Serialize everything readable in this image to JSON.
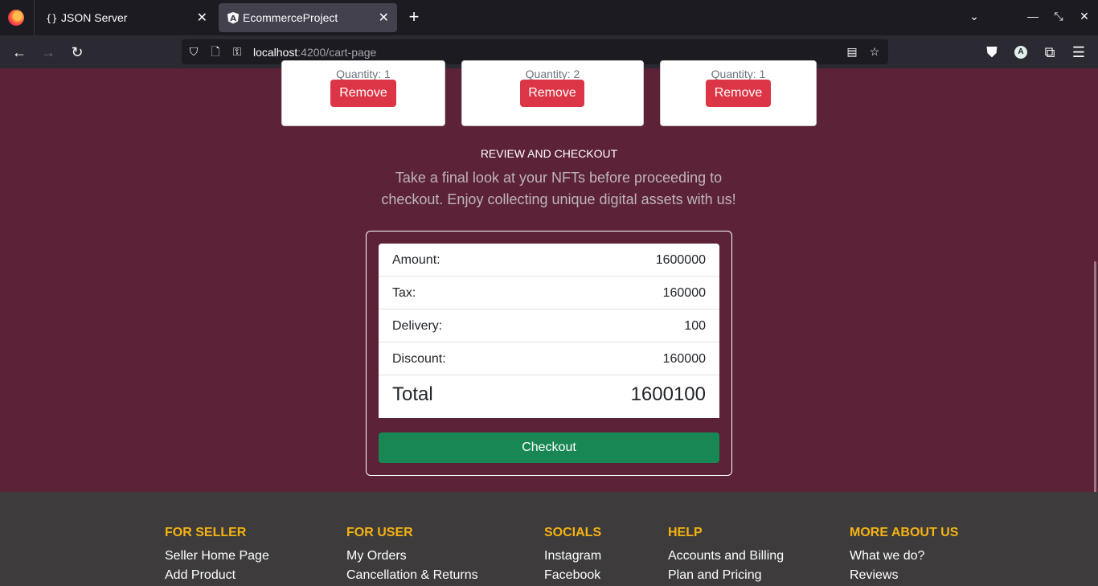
{
  "browser": {
    "tabs": [
      {
        "title": "JSON Server",
        "active": false
      },
      {
        "title": "EcommerceProject",
        "active": true
      }
    ],
    "url_host": "localhost",
    "url_path": ":4200/cart-page",
    "profile_initial": "A"
  },
  "cart": {
    "items": [
      {
        "quantity_label": "Quantity: 1",
        "remove_label": "Remove"
      },
      {
        "quantity_label": "Quantity: 2",
        "remove_label": "Remove"
      },
      {
        "quantity_label": "Quantity: 1",
        "remove_label": "Remove"
      }
    ]
  },
  "review": {
    "title": "REVIEW AND CHECKOUT",
    "subtitle": "Take a final look at your NFTs before proceeding to checkout. Enjoy collecting unique digital assets with us!"
  },
  "summary": {
    "amount_label": "Amount:",
    "amount_value": "1600000",
    "tax_label": "Tax:",
    "tax_value": "160000",
    "delivery_label": "Delivery:",
    "delivery_value": "100",
    "discount_label": "Discount:",
    "discount_value": "160000",
    "total_label": "Total",
    "total_value": "1600100",
    "checkout_label": "Checkout"
  },
  "footer": {
    "columns": [
      {
        "heading": "FOR SELLER",
        "links": [
          "Seller Home Page",
          "Add Product"
        ]
      },
      {
        "heading": "FOR USER",
        "links": [
          "My Orders",
          "Cancellation & Returns"
        ]
      },
      {
        "heading": "SOCIALS",
        "links": [
          "Instagram",
          "Facebook"
        ]
      },
      {
        "heading": "HELP",
        "links": [
          "Accounts and Billing",
          "Plan and Pricing"
        ]
      },
      {
        "heading": "MORE ABOUT US",
        "links": [
          "What we do?",
          "Reviews"
        ]
      }
    ]
  },
  "colors": {
    "page_bg": "#5b2238",
    "remove": "#dc3545",
    "checkout": "#198754",
    "footer_bg": "#3d3b3c",
    "footer_heading": "#f5b311"
  }
}
